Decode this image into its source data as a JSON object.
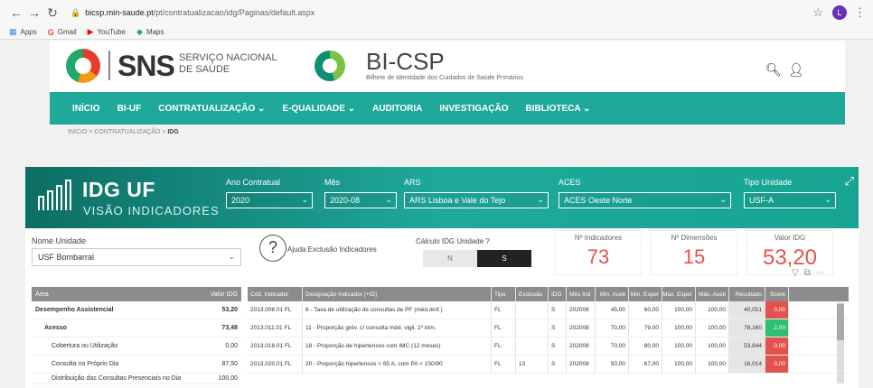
{
  "browser": {
    "url_host": "bicsp.min-saude.pt",
    "url_path": "/pt/contratualizacao/idg/Paginas/default.aspx",
    "profile_initial": "L",
    "bookmarks": [
      "Apps",
      "Gmail",
      "YouTube",
      "Maps"
    ]
  },
  "header": {
    "sns": "SNS",
    "sns_sub": "SERVIÇO NACIONAL DE SAÚDE",
    "bi_title": "BI-CSP",
    "bi_sub": "Bilhete de Identidade dos Cuidados de Saúde Primários"
  },
  "nav": [
    "INÍCIO",
    "BI-UF",
    "CONTRATUALIZAÇÃO ⌄",
    "E-QUALIDADE ⌄",
    "AUDITORIA",
    "INVESTIGAÇÃO",
    "BIBLIOTECA ⌄"
  ],
  "breadcrumb": {
    "path": "INÍCIO > CONTRATUALIZAÇÃO > ",
    "current": "IDG"
  },
  "report": {
    "title": "IDG UF",
    "subtitle": "VISÃO INDICADORES",
    "filters": [
      {
        "label": "Ano Contratual",
        "value": "2020"
      },
      {
        "label": "Mês",
        "value": "2020-08"
      },
      {
        "label": "ARS",
        "value": "ARS Lisboa e Vale do Tejo"
      },
      {
        "label": "ACES",
        "value": "ACES Oeste Norte"
      },
      {
        "label": "Tipo Unidade",
        "value": "USF-A"
      }
    ],
    "unit_label": "Nome Unidade",
    "unit_value": "USF Bombarral",
    "help_label": "Ajuda Exclusão Indicadores",
    "calc_label": "Cálculo IDG Unidade ?",
    "toggle_n": "N",
    "toggle_s": "S",
    "kpis": [
      {
        "label": "Nº Indicadores",
        "value": "73"
      },
      {
        "label": "Nº Dimensões",
        "value": "15"
      },
      {
        "label": "Valor IDG",
        "value": "53,20"
      }
    ],
    "area_table": {
      "headers": [
        "Área",
        "Valor IDG"
      ],
      "rows": [
        {
          "name": "Desempenho Assistencial",
          "value": "53,20",
          "bold": true
        },
        {
          "name": "Acesso",
          "value": "73,48",
          "bold": true
        },
        {
          "name": "Cobertura ou Utilização",
          "value": "0,00",
          "bold": false
        },
        {
          "name": "Consulta no Próprio Dia",
          "value": "87,50",
          "bold": false
        },
        {
          "name": "Distribuição das Consultas Presenciais no Dia",
          "value": "100,00",
          "bold": false
        }
      ]
    },
    "ind_table": {
      "headers": [
        "Cód. Indicador",
        "Designação Indicador (+ID)",
        "Tipo",
        "Exclusão",
        "IDG",
        "Mês Ind",
        "Min. Aceit",
        "Min. Esper",
        "Máx. Esper",
        "Máx. Aceit",
        "Resultado",
        "Score"
      ],
      "rows": [
        {
          "cod": "2013.008.01 FL",
          "des": "6 - Taxa de utilização de consultas de PF (méd./enf.)",
          "tipo": "FL",
          "exc": "",
          "idg": "S",
          "mes": "202008",
          "min_a": "45,00",
          "min_e": "60,00",
          "max_e": "100,00",
          "max_a": "100,00",
          "res": "40,051",
          "score": "0,00",
          "score_color": "red"
        },
        {
          "cod": "2013.011.01 FL",
          "des": "11 - Proporção grév. c/ consulta méd. vigil. 1º trim.",
          "tipo": "FL",
          "exc": "",
          "idg": "S",
          "mes": "202008",
          "min_a": "70,00",
          "min_e": "79,00",
          "max_e": "100,00",
          "max_a": "100,00",
          "res": "78,160",
          "score": "2,00",
          "score_color": "green"
        },
        {
          "cod": "2013.018.01 FL",
          "des": "18 - Proporção de hipertensos com IMC (12 meses)",
          "tipo": "FL",
          "exc": "",
          "idg": "S",
          "mes": "202008",
          "min_a": "70,00",
          "min_e": "80,00",
          "max_e": "100,00",
          "max_a": "100,00",
          "res": "53,844",
          "score": "0,00",
          "score_color": "red"
        },
        {
          "cod": "2013.020.01 FL",
          "des": "20 - Proporção hipertensos < 65 A, com PA < 150/90",
          "tipo": "FL",
          "exc": "13",
          "idg": "S",
          "mes": "202008",
          "min_a": "50,00",
          "min_e": "67,00",
          "max_e": "100,00",
          "max_a": "100,00",
          "res": "16,014",
          "score": "0,00",
          "score_color": "red"
        }
      ]
    }
  }
}
